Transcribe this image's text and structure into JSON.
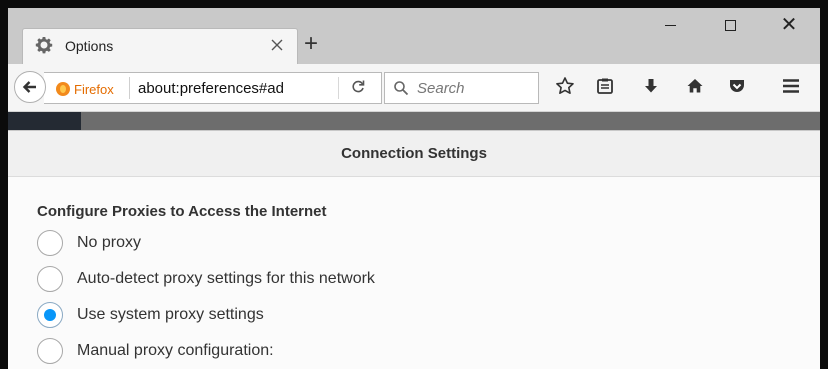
{
  "tab": {
    "title": "Options",
    "icon": "gear-icon"
  },
  "new_tab_symbol": "+",
  "window_controls": {
    "close_symbol": "✕"
  },
  "navbar": {
    "identity_label": "Firefox",
    "url": "about:preferences#ad",
    "search_placeholder": "Search",
    "reload_symbol": "C"
  },
  "toolbar_icons": [
    "star-icon",
    "reading-list-icon",
    "download-icon",
    "home-icon",
    "pocket-icon",
    "menu-icon"
  ],
  "dialog": {
    "title": "Connection Settings",
    "section_title": "Configure Proxies to Access the Internet",
    "options": [
      {
        "label": "No proxy",
        "checked": false
      },
      {
        "label": "Auto-detect proxy settings for this network",
        "checked": false
      },
      {
        "label": "Use system proxy settings",
        "checked": true
      },
      {
        "label": "Manual proxy configuration:",
        "checked": false
      }
    ]
  },
  "colors": {
    "accent": "#0996f8",
    "identity": "#e46c00"
  }
}
